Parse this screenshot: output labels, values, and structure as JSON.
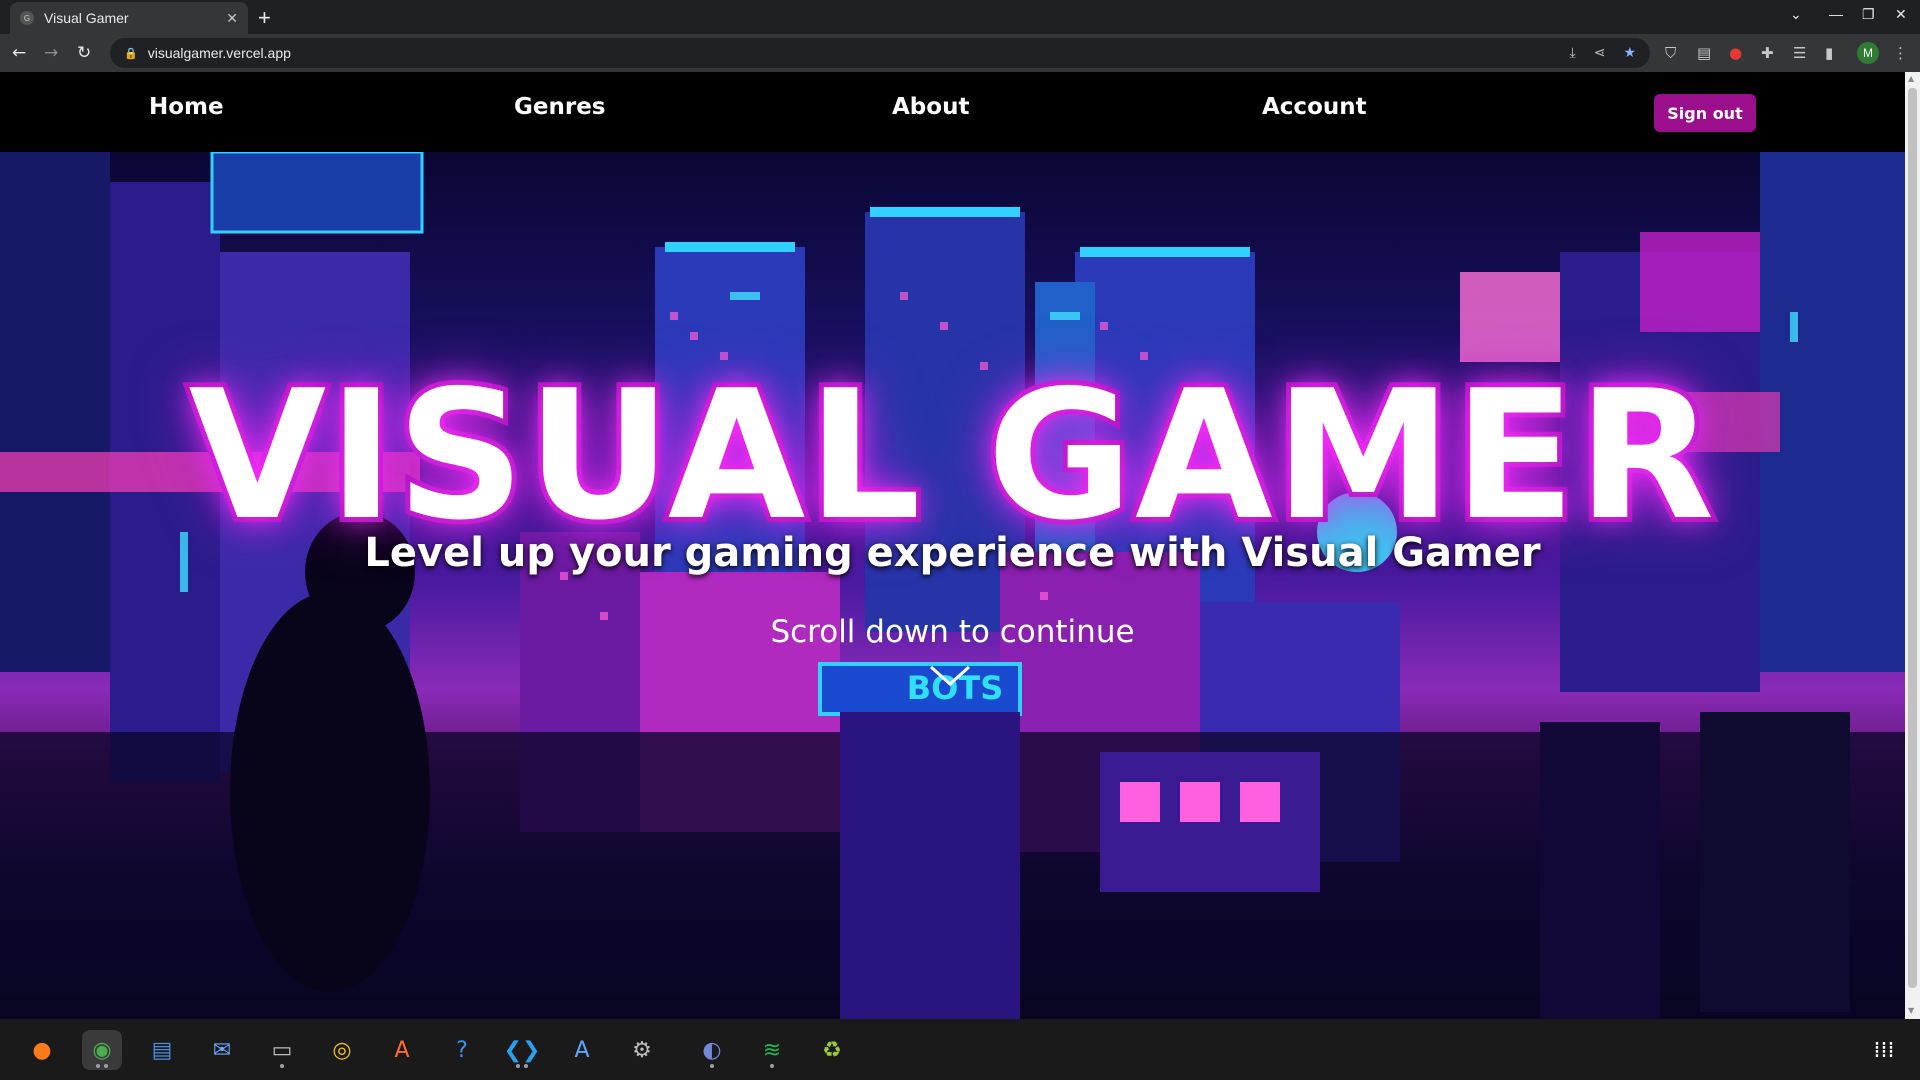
{
  "browser": {
    "tab_title": "Visual Gamer",
    "tab_favicon": "G",
    "tab_close": "✕",
    "new_tab": "+",
    "url": "visualgamer.vercel.app",
    "avatar_letter": "M",
    "window_controls": [
      "⌄",
      "—",
      "❐",
      "✕"
    ]
  },
  "site": {
    "nav": [
      "Home",
      "Genres",
      "About",
      "Account"
    ],
    "sign_out": "Sign out",
    "hero_title": "VISUAL GAMER",
    "hero_subtitle": "Level up your gaming experience with Visual Gamer",
    "scroll_hint": "Scroll down to continue"
  },
  "colors": {
    "accent": "#9c0f8c",
    "title_glow": "#ff30ff"
  },
  "taskbar": {
    "apps": [
      "firefox-icon",
      "chrome-icon",
      "text-editor-icon",
      "thunderbird-icon",
      "files-icon",
      "rhythmbox-icon",
      "software-center-icon",
      "help-icon",
      "vscode-icon",
      "app-store-icon",
      "settings-icon",
      "discord-icon",
      "spotify-icon",
      "trash-icon"
    ],
    "apps_grid": "apps-grid-icon"
  }
}
